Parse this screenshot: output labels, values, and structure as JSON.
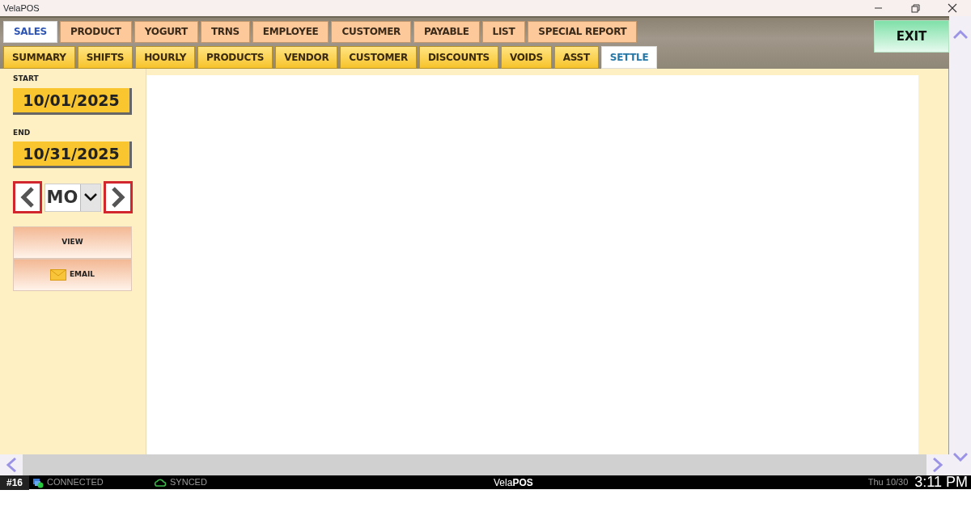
{
  "window": {
    "title": "VelaPOS"
  },
  "main_tabs": [
    {
      "label": "SALES",
      "selected": true
    },
    {
      "label": "PRODUCT",
      "selected": false
    },
    {
      "label": "YOGURT",
      "selected": false
    },
    {
      "label": "TRNS",
      "selected": false
    },
    {
      "label": "EMPLOYEE",
      "selected": false
    },
    {
      "label": "CUSTOMER",
      "selected": false
    },
    {
      "label": "PAYABLE",
      "selected": false
    },
    {
      "label": "LIST",
      "selected": false
    },
    {
      "label": "SPECIAL REPORT",
      "selected": false
    }
  ],
  "report_tabs": [
    {
      "label": "SUMMARY",
      "selected": false
    },
    {
      "label": "SHIFTS",
      "selected": false
    },
    {
      "label": "HOURLY",
      "selected": false
    },
    {
      "label": "PRODUCTS",
      "selected": false
    },
    {
      "label": "VENDOR",
      "selected": false
    },
    {
      "label": "CUSTOMER",
      "selected": false
    },
    {
      "label": "DISCOUNTS",
      "selected": false
    },
    {
      "label": "VOIDS",
      "selected": false
    },
    {
      "label": "ASST",
      "selected": false
    },
    {
      "label": "SETTLE",
      "selected": true
    }
  ],
  "exit_button": "EXIT",
  "sidebar": {
    "start_label": "START",
    "start_date": "10/01/2025",
    "end_label": "END",
    "end_date": "10/31/2025",
    "period": "MO",
    "view_button": "VIEW",
    "email_button": "EMAIL"
  },
  "status_bar": {
    "station": "#16",
    "connection": "CONNECTED",
    "sync": "SYNCED",
    "brand": "Vela**POS**",
    "date": "Thu 10/30",
    "time": "3:11 PM"
  }
}
